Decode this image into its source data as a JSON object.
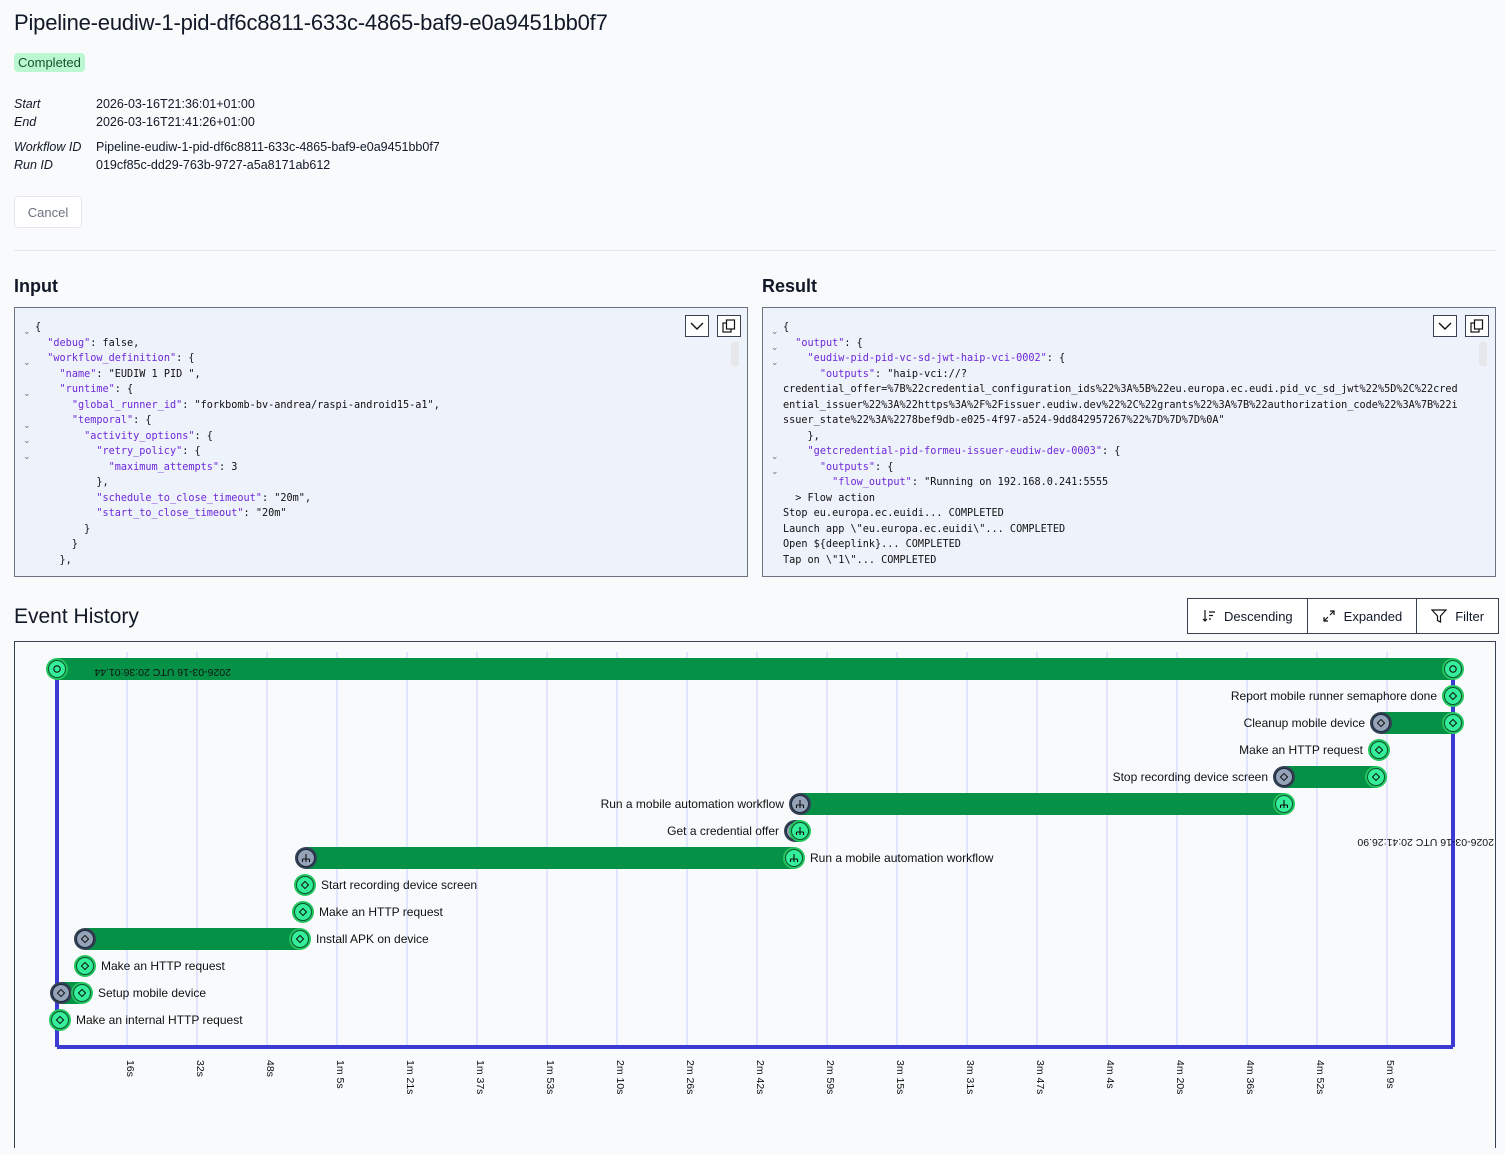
{
  "header": {
    "title": "Pipeline-eudiw-1-pid-df6c8811-633c-4865-baf9-e0a9451bb0f7",
    "status": "Completed"
  },
  "meta": {
    "start_label": "Start",
    "start_value": "2026-03-16T21:36:01+01:00",
    "end_label": "End",
    "end_value": "2026-03-16T21:41:26+01:00",
    "workflow_id_label": "Workflow ID",
    "workflow_id_value": "Pipeline-eudiw-1-pid-df6c8811-633c-4865-baf9-e0a9451bb0f7",
    "run_id_label": "Run ID",
    "run_id_value": "019cf85c-dd29-763b-9727-a5a8171ab612"
  },
  "actions": {
    "cancel_label": "Cancel"
  },
  "input": {
    "title": "Input",
    "lines": [
      "{",
      "  \"debug\": false,",
      "  \"workflow_definition\": {",
      "    \"name\": \"EUDIW 1 PID \",",
      "    \"runtime\": {",
      "      \"global_runner_id\": \"forkbomb-bv-andrea/raspi-android15-a1\",",
      "      \"temporal\": {",
      "        \"activity_options\": {",
      "          \"retry_policy\": {",
      "            \"maximum_attempts\": 3",
      "          },",
      "          \"schedule_to_close_timeout\": \"20m\",",
      "          \"start_to_close_timeout\": \"20m\"",
      "        }",
      "      }",
      "    },"
    ]
  },
  "result": {
    "title": "Result",
    "lines": [
      "{",
      "  \"output\": {",
      "    \"eudiw-pid-pid-vc-sd-jwt-haip-vci-0002\": {",
      "      \"outputs\": \"haip-vci://?",
      "credential_offer=%7B%22credential_configuration_ids%22%3A%5B%22eu.europa.ec.eudi.pid_vc_sd_jwt%22%5D%2C%22cred",
      "ential_issuer%22%3A%22https%3A%2F%2Fissuer.eudiw.dev%22%2C%22grants%22%3A%7B%22authorization_code%22%3A%7B%22i",
      "ssuer_state%22%3A%2278bef9db-e025-4f97-a524-9dd842957267%22%7D%7D%7D%0A\"",
      "    },",
      "    \"getcredential-pid-formeu-issuer-eudiw-dev-0003\": {",
      "      \"outputs\": {",
      "        \"flow_output\": \"Running on 192.168.0.241:5555",
      "",
      "Stop eu.europa.ec.euidi... COMPLETED",
      "Launch app \\\"eu.europa.ec.euidi\\\"... COMPLETED",
      "Open ${deeplink}... COMPLETED",
      "Tap on \\\"1\\\"... COMPLETED"
    ],
    "flow_action": "> Flow action"
  },
  "event_history": {
    "title": "Event History",
    "toolbar": {
      "sort_label": "Descending",
      "expand_label": "Expanded",
      "filter_label": "Filter"
    },
    "start_timestamp": "2026-03-16 UTC 20:36:01.44",
    "end_timestamp": "2026-03-16 UTC 20:41:26.90",
    "ticks": [
      "16s",
      "32s",
      "48s",
      "1m 5s",
      "1m 21s",
      "1m 37s",
      "1m 53s",
      "2m 10s",
      "2m 26s",
      "2m 42s",
      "2m 59s",
      "3m 15s",
      "3m 31s",
      "3m 47s",
      "4m 4s",
      "4m 20s",
      "4m 36s",
      "4m 52s",
      "5m 9s"
    ],
    "events": [
      {
        "label": "Report mobile runner semaphore done",
        "icon": "activity-icon"
      },
      {
        "label": "Cleanup mobile device",
        "icon": "activity-icon"
      },
      {
        "label": "Make an HTTP request",
        "icon": "activity-icon"
      },
      {
        "label": "Stop recording device screen",
        "icon": "activity-icon"
      },
      {
        "label": "Run a mobile automation workflow",
        "icon": "child-workflow-icon"
      },
      {
        "label": "Get a credential offer",
        "icon": "child-workflow-icon"
      },
      {
        "label": "Run a mobile automation workflow",
        "icon": "child-workflow-icon"
      },
      {
        "label": "Start recording device screen",
        "icon": "activity-icon"
      },
      {
        "label": "Make an HTTP request",
        "icon": "activity-icon"
      },
      {
        "label": "Install APK on device",
        "icon": "activity-icon"
      },
      {
        "label": "Make an HTTP request",
        "icon": "activity-icon"
      },
      {
        "label": "Setup mobile device",
        "icon": "activity-icon"
      },
      {
        "label": "Make an internal HTTP request",
        "icon": "activity-icon"
      }
    ]
  }
}
